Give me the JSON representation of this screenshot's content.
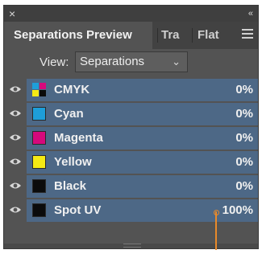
{
  "panel": {
    "close_glyph": "×",
    "collapse_glyph": "«",
    "tabs": [
      {
        "label": "Separations Preview",
        "active": true
      },
      {
        "label": "Tra",
        "active": false
      },
      {
        "label": "Flat",
        "active": false
      }
    ],
    "menu_icon": "hamburger-menu-icon",
    "view_label": "View:",
    "view_value": "Separations",
    "view_chevron": "⌄"
  },
  "separations": [
    {
      "name": "CMYK",
      "value": "0%",
      "swatch": "cmyk",
      "visible": true
    },
    {
      "name": "Cyan",
      "value": "0%",
      "swatch": "#1e9ed9",
      "visible": true
    },
    {
      "name": "Magenta",
      "value": "0%",
      "swatch": "#d6097c",
      "visible": true
    },
    {
      "name": "Yellow",
      "value": "0%",
      "swatch": "#f5ea14",
      "visible": true
    },
    {
      "name": "Black",
      "value": "0%",
      "swatch": "#0b0b0b",
      "visible": true
    },
    {
      "name": "Spot UV",
      "value": "100%",
      "swatch": "#0b0b0b",
      "visible": true
    }
  ],
  "colors": {
    "panel_bg": "#535353",
    "row_highlight": "#4d6886",
    "accent": "#e98a2a"
  }
}
